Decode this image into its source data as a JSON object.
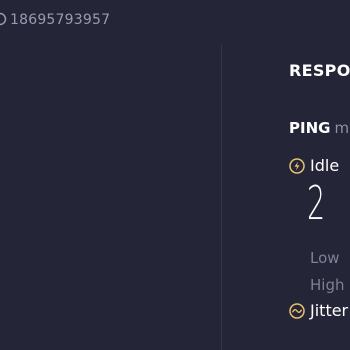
{
  "result": {
    "id_text": "18695793957"
  },
  "responsiveness": {
    "title": "RESPONSIVENESS",
    "ping_label": "PING",
    "ping_unit": "ms",
    "idle": {
      "label": "Idle",
      "value": "2",
      "low_label": "Low",
      "high_label": "High"
    },
    "jitter": {
      "label": "Jitter"
    }
  },
  "colors": {
    "background": "#252538",
    "accent_gold": "#e8c070",
    "muted_text": "#8f8fa8"
  },
  "icons": {
    "idle": "bolt-circle-icon",
    "jitter": "wave-circle-icon",
    "result": "link-icon"
  }
}
